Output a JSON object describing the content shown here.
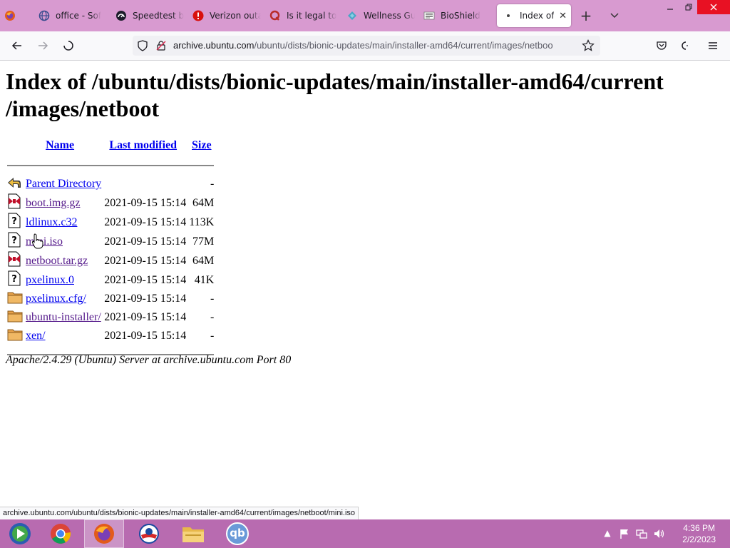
{
  "browser": {
    "tabs": [
      {
        "title": "office - Sof",
        "icon": "office-globe-icon"
      },
      {
        "title": "Speedtest b",
        "icon": "speedtest-icon"
      },
      {
        "title": "Verizon outa",
        "icon": "alert-icon"
      },
      {
        "title": "Is it legal to",
        "icon": "quora-icon"
      },
      {
        "title": "Wellness Gu",
        "icon": "wellness-icon"
      },
      {
        "title": "BioShield",
        "icon": "bioshield-icon"
      },
      {
        "title": "Index of",
        "icon": "dot-icon",
        "active": true
      }
    ],
    "new_tab_label": "+",
    "url_host": "archive.ubuntu.com",
    "url_path": "/ubuntu/dists/bionic-updates/main/installer-amd64/current/images/netboo",
    "status_url": "archive.ubuntu.com/ubuntu/dists/bionic-updates/main/installer-amd64/current/images/netboot/mini.iso"
  },
  "page": {
    "title": "Index of /ubuntu/dists/bionic-updates/main/installer-amd64/current /images/netboot",
    "columns": {
      "name": "Name",
      "modified": "Last modified",
      "size": "Size"
    },
    "rows": [
      {
        "icon": "back-icon",
        "name": "Parent Directory",
        "modified": "",
        "size": "-"
      },
      {
        "icon": "compressed-file-icon",
        "name": "boot.img.gz",
        "modified": "2021-09-15 15:14",
        "size": "64M",
        "visited": true
      },
      {
        "icon": "unknown-file-icon",
        "name": "ldlinux.c32",
        "modified": "2021-09-15 15:14",
        "size": "113K"
      },
      {
        "icon": "unknown-file-icon",
        "name": "mini.iso",
        "modified": "2021-09-15 15:14",
        "size": "77M",
        "visited": true
      },
      {
        "icon": "compressed-file-icon",
        "name": "netboot.tar.gz",
        "modified": "2021-09-15 15:14",
        "size": "64M",
        "visited": true
      },
      {
        "icon": "unknown-file-icon",
        "name": "pxelinux.0",
        "modified": "2021-09-15 15:14",
        "size": "41K"
      },
      {
        "icon": "folder-icon",
        "name": "pxelinux.cfg/",
        "modified": "2021-09-15 15:14",
        "size": "-"
      },
      {
        "icon": "folder-icon",
        "name": "ubuntu-installer/",
        "modified": "2021-09-15 15:14",
        "size": "-",
        "visited": true
      },
      {
        "icon": "folder-icon",
        "name": "xen/",
        "modified": "2021-09-15 15:14",
        "size": "-"
      }
    ],
    "server_signature": "Apache/2.4.29 (Ubuntu) Server at archive.ubuntu.com Port 80"
  },
  "taskbar": {
    "apps": [
      "media-center-icon",
      "chrome-icon",
      "firefox-icon",
      "obama-icon",
      "file-explorer-icon",
      "qbittorrent-icon"
    ],
    "qb_label": "qb",
    "time": "4:36 PM",
    "date": "2/2/2023"
  },
  "colors": {
    "tabbar": "#d89ad0",
    "taskbar": "#b86bb0",
    "link": "#0000ee",
    "visited": "#551a8b"
  }
}
